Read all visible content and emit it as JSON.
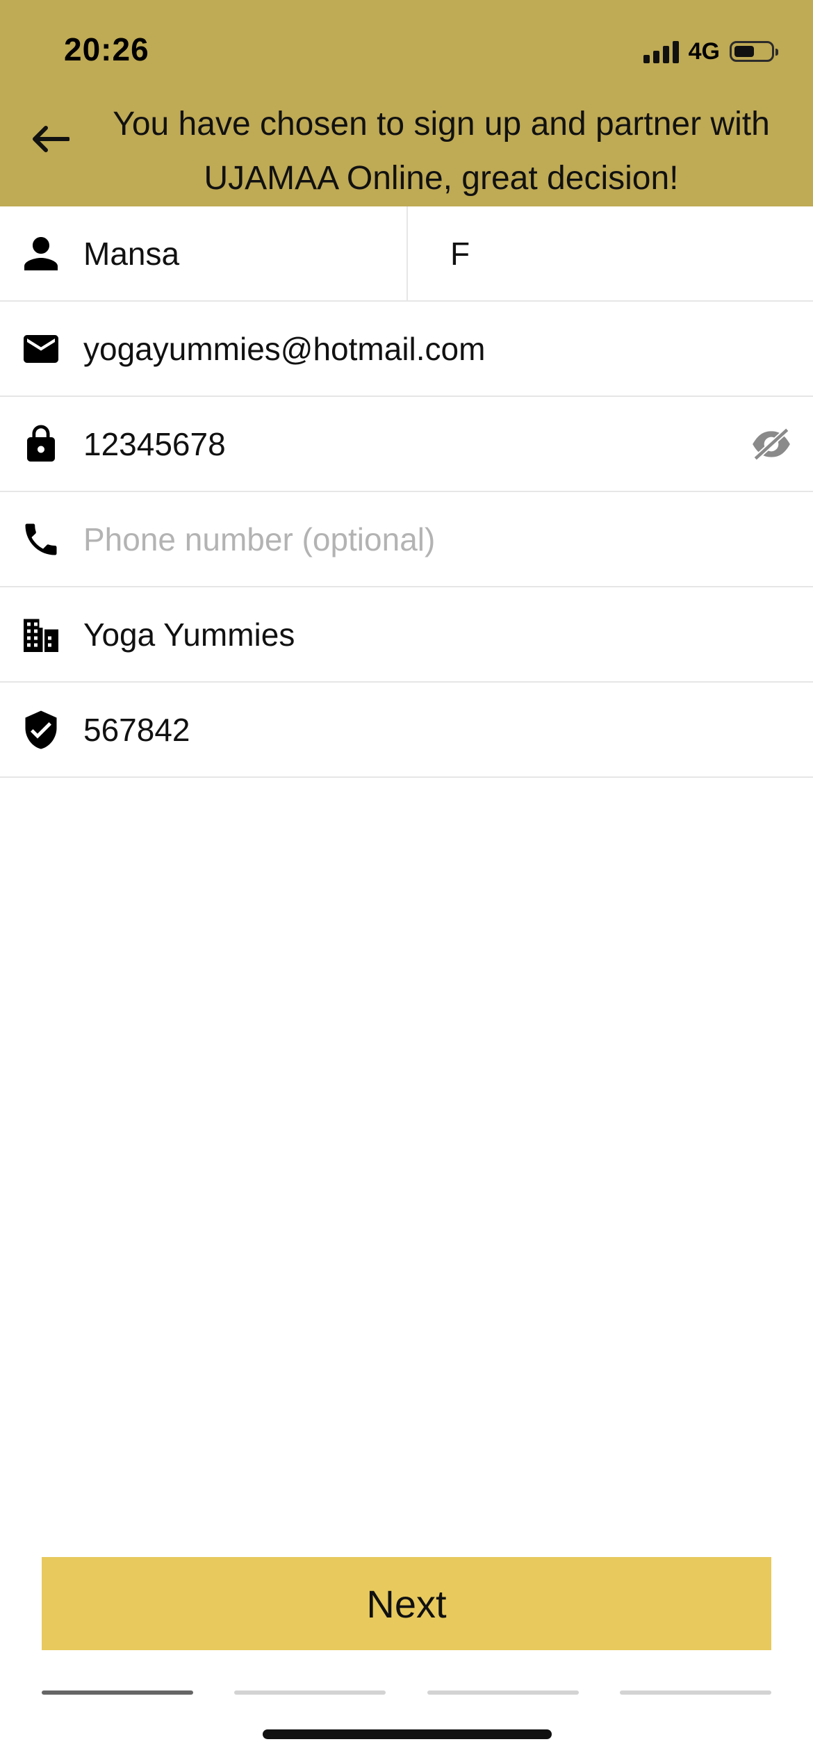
{
  "status_bar": {
    "time": "20:26",
    "network": "4G",
    "battery_percent": 45
  },
  "header": {
    "title": "You have chosen to sign up and partner with UJAMAA Online, great decision!",
    "background_color": "#bfaa55",
    "back_icon": "arrow-left-icon"
  },
  "form": {
    "first_name": {
      "value": "Mansa",
      "icon": "person-icon"
    },
    "last_name": {
      "value": "F"
    },
    "email": {
      "value": "yogayummies@hotmail.com",
      "icon": "envelope-icon"
    },
    "password": {
      "value": "12345678",
      "icon": "lock-icon",
      "toggle_icon": "eye-off-icon"
    },
    "phone": {
      "value": "",
      "placeholder": "Phone number (optional)",
      "icon": "phone-icon"
    },
    "business": {
      "value": "Yoga Yummies",
      "icon": "building-icon"
    },
    "code": {
      "value": "567842",
      "icon": "shield-check-icon"
    }
  },
  "next_button": {
    "label": "Next",
    "color": "#e7c95d"
  },
  "stepper": {
    "total_steps": 4,
    "current_step": 1
  }
}
